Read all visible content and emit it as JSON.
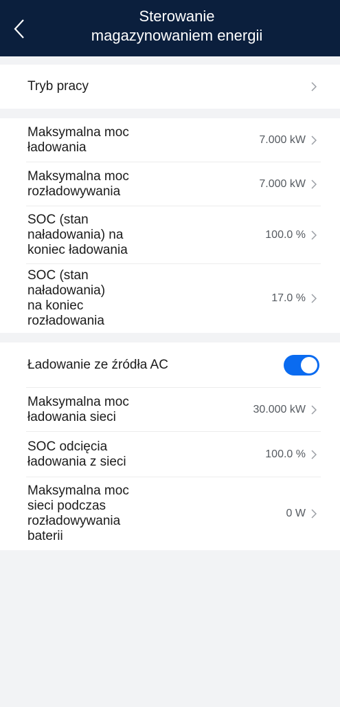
{
  "header": {
    "title": "Sterowanie\nmagazynowaniem energii",
    "back_icon": "chevron-left-icon"
  },
  "sections": {
    "work_mode": {
      "label": "Tryb pracy"
    },
    "charge": [
      {
        "label": "Maksymalna moc\nładowania",
        "value": "7.000 kW"
      },
      {
        "label": "Maksymalna moc\nrozładowywania",
        "value": "7.000 kW"
      },
      {
        "label": "SOC (stan\nnaładowania) na\nkoniec ładowania",
        "value": "100.0 %"
      },
      {
        "label": "SOC (stan\nnaładowania)\nna koniec\nrozładowania",
        "value": "17.0 %"
      }
    ],
    "ac": {
      "toggle_label": "Ładowanie ze źródła AC",
      "toggle_on": true,
      "items": [
        {
          "label": "Maksymalna moc\nładowania sieci",
          "value": "30.000 kW"
        },
        {
          "label": "SOC odcięcia\nładowania z sieci",
          "value": "100.0 %"
        },
        {
          "label": "Maksymalna moc\nsieci podczas\nrozładowywania\nbaterii",
          "value": "0 W"
        }
      ]
    }
  },
  "colors": {
    "header_bg": "#0b1f3d",
    "toggle_on": "#0a6bf0",
    "page_bg": "#f2f3f5"
  }
}
